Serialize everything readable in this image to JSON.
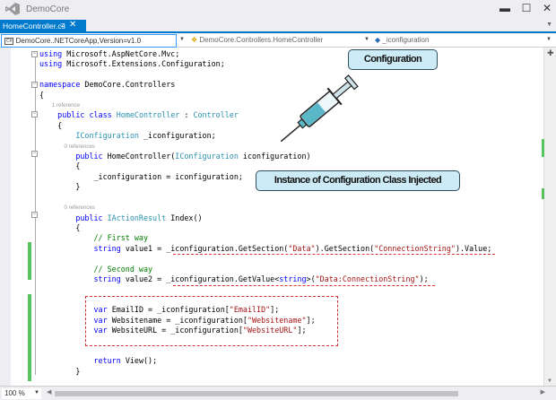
{
  "window": {
    "title": "DemoCore",
    "minimize": "▬",
    "maximize": "☐",
    "close": "✕"
  },
  "tab": {
    "label": "HomeController.cs",
    "pin": "⊐",
    "close": "✕"
  },
  "nav": {
    "project": "DemoCore..NETCoreApp,Version=v1.0",
    "class": "DemoCore.Controllers.HomeController",
    "member": "_iconfiguration"
  },
  "code_lines": [
    [
      [
        "kw",
        "using"
      ],
      [
        "",
        " Microsoft.AspNetCore.Mvc;"
      ]
    ],
    [
      [
        "kw",
        "using"
      ],
      [
        "",
        " Microsoft.Extensions.Configuration;"
      ]
    ],
    [],
    [
      [
        "kw",
        "namespace"
      ],
      [
        "",
        " DemoCore.Controllers"
      ]
    ],
    [
      [
        "",
        "{"
      ]
    ],
    [
      [
        "ref",
        "        1 reference"
      ]
    ],
    [
      [
        "",
        "    "
      ],
      [
        "kw",
        "public class "
      ],
      [
        "ty",
        "HomeController"
      ],
      [
        "",
        " : "
      ],
      [
        "ty",
        "Controller"
      ]
    ],
    [
      [
        "",
        "    {"
      ]
    ],
    [
      [
        "",
        "        "
      ],
      [
        "ty",
        "IConfiguration"
      ],
      [
        "",
        " _iconfiguration;"
      ]
    ],
    [
      [
        "ref",
        "                0 references"
      ]
    ],
    [
      [
        "",
        "        "
      ],
      [
        "kw",
        "public "
      ],
      [
        "",
        "HomeController("
      ],
      [
        "ty",
        "IConfiguration"
      ],
      [
        "",
        " iconfiguration)"
      ]
    ],
    [
      [
        "",
        "        {"
      ]
    ],
    [
      [
        "",
        "            _iconfiguration = iconfiguration;"
      ]
    ],
    [
      [
        "",
        "        }"
      ]
    ],
    [],
    [
      [
        "ref",
        "                0 references"
      ]
    ],
    [
      [
        "",
        "        "
      ],
      [
        "kw",
        "public "
      ],
      [
        "ty",
        "IActionResult"
      ],
      [
        "",
        " Index()"
      ]
    ],
    [
      [
        "",
        "        {"
      ]
    ],
    [
      [
        "",
        "            "
      ],
      [
        "cm",
        "// First way"
      ]
    ],
    [
      [
        "",
        "            "
      ],
      [
        "kw",
        "string"
      ],
      [
        "",
        " value1 = _iconfiguration.GetSection("
      ],
      [
        "st",
        "\"Data\""
      ],
      [
        "",
        ").GetSection("
      ],
      [
        "st",
        "\"ConnectionString\""
      ],
      [
        "",
        ").Value;"
      ]
    ],
    [],
    [
      [
        "",
        "            "
      ],
      [
        "cm",
        "// Second way"
      ]
    ],
    [
      [
        "",
        "            "
      ],
      [
        "kw",
        "string"
      ],
      [
        "",
        " value2 = _iconfiguration.GetValue<"
      ],
      [
        "kw",
        "string"
      ],
      [
        "",
        ">("
      ],
      [
        "st",
        "\"Data:ConnectionString\""
      ],
      [
        "",
        ");"
      ]
    ],
    [],
    [],
    [
      [
        "",
        "            "
      ],
      [
        "kw",
        "var"
      ],
      [
        "",
        " EmailID = _iconfiguration["
      ],
      [
        "st",
        "\"EmailID\""
      ],
      [
        "",
        "];"
      ]
    ],
    [
      [
        "",
        "            "
      ],
      [
        "kw",
        "var"
      ],
      [
        "",
        " Websitename = _iconfiguration["
      ],
      [
        "st",
        "\"Websitename\""
      ],
      [
        "",
        "];"
      ]
    ],
    [
      [
        "",
        "            "
      ],
      [
        "kw",
        "var"
      ],
      [
        "",
        " WebsiteURL = _iconfiguration["
      ],
      [
        "st",
        "\"WebsiteURL\""
      ],
      [
        "",
        "];"
      ]
    ],
    [],
    [],
    [
      [
        "",
        "            "
      ],
      [
        "kw",
        "return"
      ],
      [
        "",
        " View();"
      ]
    ],
    [
      [
        "",
        "        }"
      ]
    ]
  ],
  "annotations": {
    "configuration": "Configuration",
    "injected": "Instance of Configuration Class Injected"
  },
  "status": {
    "zoom": "100 %"
  }
}
